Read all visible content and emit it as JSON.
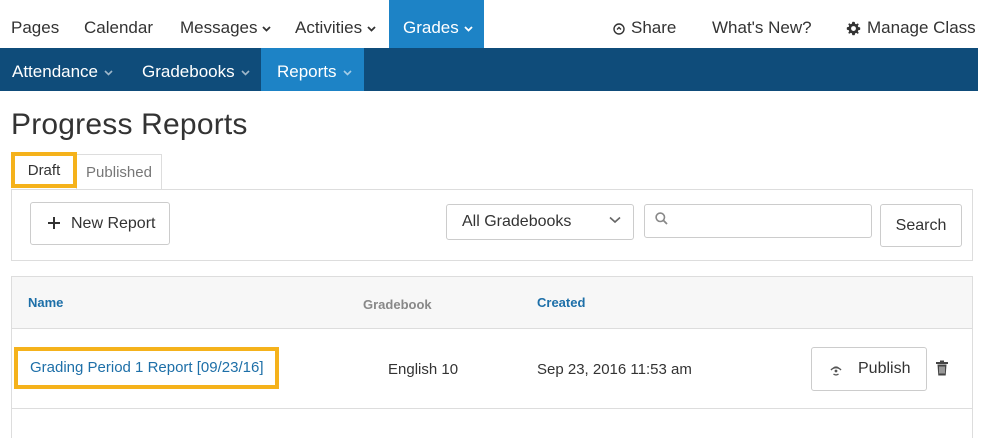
{
  "topnav": {
    "items": [
      {
        "label": "Pages"
      },
      {
        "label": "Calendar"
      },
      {
        "label": "Messages"
      },
      {
        "label": "Activities"
      },
      {
        "label": "Grades"
      }
    ],
    "share": "Share",
    "whats_new": "What's New?",
    "manage_class": "Manage Class"
  },
  "subnav": {
    "items": [
      {
        "label": "Attendance"
      },
      {
        "label": "Gradebooks"
      },
      {
        "label": "Reports"
      }
    ]
  },
  "page": {
    "title": "Progress Reports"
  },
  "tabs": {
    "draft": "Draft",
    "published": "Published"
  },
  "toolbar": {
    "new_report": "New Report",
    "gradebook_select": "All Gradebooks",
    "search_placeholder": "",
    "search_button": "Search"
  },
  "table": {
    "headers": {
      "name": "Name",
      "gradebook": "Gradebook",
      "created": "Created"
    },
    "rows": [
      {
        "name": "Grading Period 1 Report [09/23/16]",
        "gradebook": "English 10",
        "created": "Sep 23, 2016 11:53 am",
        "action": "Publish"
      }
    ]
  },
  "colors": {
    "accent": "#1d83c6",
    "subnav_bg": "#0f4c7a",
    "highlight": "#f5b21b",
    "link": "#1d6fa8"
  }
}
